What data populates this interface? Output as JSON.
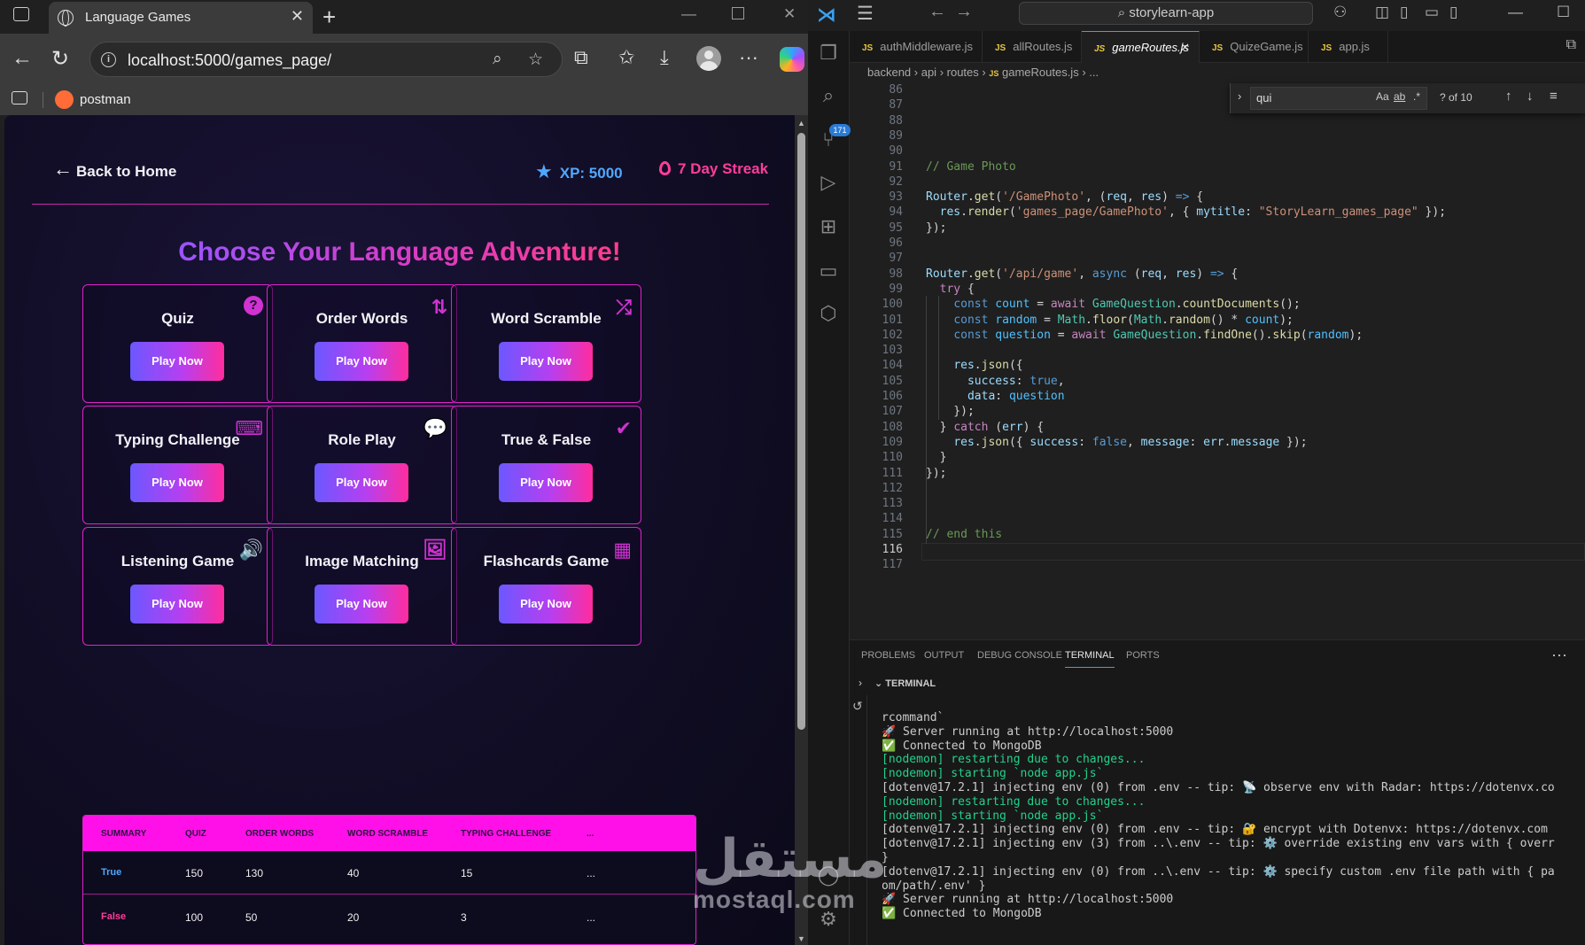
{
  "browser": {
    "tab_title": "Language Games",
    "url": "localhost:5000/games_page/",
    "bookmark": "postman",
    "icons": [
      "tab-actions-icon",
      "globe-icon",
      "close-icon",
      "new-tab-icon",
      "minimize-icon",
      "maximize-icon",
      "back-icon",
      "reload-icon",
      "info-icon",
      "zoom-icon",
      "star-icon",
      "extensions-icon",
      "favorites-icon",
      "downloads-icon",
      "profile-icon",
      "more-icon",
      "copilot-icon"
    ]
  },
  "page": {
    "back_label": "Back to Home",
    "xp_label": "XP: 5000",
    "streak_label": "7 Day Streak",
    "title": "Choose Your Language Adventure!",
    "play_label": "Play Now",
    "games": [
      {
        "title": "Quiz",
        "icon": "question-icon"
      },
      {
        "title": "Order Words",
        "icon": "sort-icon"
      },
      {
        "title": "Word Scramble",
        "icon": "shuffle-icon"
      },
      {
        "title": "Typing Challenge",
        "icon": "keyboard-icon"
      },
      {
        "title": "Role Play",
        "icon": "chat-icon"
      },
      {
        "title": "True & False",
        "icon": "check-icon"
      },
      {
        "title": "Listening Game",
        "icon": "speaker-icon"
      },
      {
        "title": "Image Matching",
        "icon": "image-icon"
      },
      {
        "title": "Flashcards Game",
        "icon": "grid-icon"
      }
    ],
    "colors": {
      "accent": "#e022c9",
      "xp": "#4fa8ff",
      "streak": "#ff3d9a",
      "table_head": "#ff10e8"
    },
    "summary": {
      "headers": [
        "SUMMARY",
        "QUIZ",
        "ORDER WORDS",
        "WORD SCRAMBLE",
        "TYPING CHALLENGE",
        "..."
      ],
      "rows": [
        {
          "label": "True",
          "values": [
            "150",
            "130",
            "40",
            "15",
            "..."
          ]
        },
        {
          "label": "False",
          "values": [
            "100",
            "50",
            "20",
            "3",
            "..."
          ]
        }
      ]
    }
  },
  "watermark": {
    "arabic": "مستقل",
    "latin": "mostaql.com"
  },
  "vscode": {
    "search": "storylearn-app",
    "tabs": [
      "authMiddleware.js",
      "allRoutes.js",
      "gameRoutes.js",
      "QuizeGame.js",
      "app.js"
    ],
    "active_tab": "gameRoutes.js",
    "tab_badge": "JS",
    "breadcrumb": [
      "backend",
      "api",
      "routes",
      "gameRoutes.js",
      "..."
    ],
    "find": {
      "query": "qui",
      "count": "? of 10",
      "opt_case": "Aa",
      "opt_word": "ab",
      "opt_regex": ".*"
    },
    "activity_badge": "171",
    "code_lines": [
      {
        "n": "86",
        "html": ""
      },
      {
        "n": "87",
        "html": ""
      },
      {
        "n": "88",
        "html": ""
      },
      {
        "n": "89",
        "html": ""
      },
      {
        "n": "90",
        "html": ""
      },
      {
        "n": "91",
        "html": "<span class='k-cm'>// Game Photo</span>"
      },
      {
        "n": "92",
        "html": ""
      },
      {
        "n": "93",
        "html": "<span class='k-var'>Router</span>.<span class='k-fn'>get</span>(<span class='k-str'>'/GamePhoto'</span>, (<span class='k-var'>req</span>, <span class='k-var'>res</span>) <span class='k-kw'>=&gt;</span> {"
      },
      {
        "n": "94",
        "html": "  <span class='k-var'>res</span>.<span class='k-fn'>render</span>(<span class='k-str'>'games_page/GamePhoto'</span>, { <span class='k-var'>mytitle</span>: <span class='k-str'>\"StoryLearn_games_page\"</span> });"
      },
      {
        "n": "95",
        "html": "});"
      },
      {
        "n": "96",
        "html": ""
      },
      {
        "n": "97",
        "html": ""
      },
      {
        "n": "98",
        "html": "<span class='k-var'>Router</span>.<span class='k-fn'>get</span>(<span class='k-str'>'/api/game'</span>, <span class='k-kw'>async</span> (<span class='k-var'>req</span>, <span class='k-var'>res</span>) <span class='k-kw'>=&gt;</span> {"
      },
      {
        "n": "99",
        "html": "  <span class='k-ctl'>try</span> {"
      },
      {
        "n": "100",
        "html": "    <span class='k-kw'>const</span> <span class='k-cst'>count</span> = <span class='k-ctl'>await</span> <span class='k-cls'>GameQuestion</span>.<span class='k-fn'>countDocuments</span>();"
      },
      {
        "n": "101",
        "html": "    <span class='k-kw'>const</span> <span class='k-cst'>random</span> = <span class='k-cls'>Math</span>.<span class='k-fn'>floor</span>(<span class='k-cls'>Math</span>.<span class='k-fn'>random</span>() * <span class='k-cst'>count</span>);"
      },
      {
        "n": "102",
        "html": "    <span class='k-kw'>const</span> <span class='k-cst'>question</span> = <span class='k-ctl'>await</span> <span class='k-cls'>GameQuestion</span>.<span class='k-fn'>findOne</span>().<span class='k-fn'>skip</span>(<span class='k-cst'>random</span>);"
      },
      {
        "n": "103",
        "html": ""
      },
      {
        "n": "104",
        "html": "    <span class='k-var'>res</span>.<span class='k-fn'>json</span>({"
      },
      {
        "n": "105",
        "html": "      <span class='k-var'>success</span>: <span class='k-kw'>true</span>,"
      },
      {
        "n": "106",
        "html": "      <span class='k-var'>data</span>: <span class='k-cst'>question</span>"
      },
      {
        "n": "107",
        "html": "    });"
      },
      {
        "n": "108",
        "html": "  } <span class='k-ctl'>catch</span> (<span class='k-var'>err</span>) {"
      },
      {
        "n": "109",
        "html": "    <span class='k-var'>res</span>.<span class='k-fn'>json</span>({ <span class='k-var'>success</span>: <span class='k-kw'>false</span>, <span class='k-var'>message</span>: <span class='k-var'>err</span>.<span class='k-var'>message</span> });"
      },
      {
        "n": "110",
        "html": "  }"
      },
      {
        "n": "111",
        "html": "});"
      },
      {
        "n": "112",
        "html": ""
      },
      {
        "n": "113",
        "html": ""
      },
      {
        "n": "114",
        "html": ""
      },
      {
        "n": "115",
        "html": "<span class='k-cm'>// end this</span>"
      },
      {
        "n": "116",
        "html": ""
      },
      {
        "n": "117",
        "html": ""
      }
    ],
    "current_line": "116",
    "panel_tabs": [
      "PROBLEMS",
      "OUTPUT",
      "DEBUG CONSOLE",
      "TERMINAL",
      "PORTS"
    ],
    "active_panel_tab": "TERMINAL",
    "terminal_title": "TERMINAL",
    "terminal_lines": [
      {
        "t": "rcommand`",
        "c": ""
      },
      {
        "t": "🚀 Server running at http://localhost:5000",
        "c": ""
      },
      {
        "t": "✅ Connected to MongoDB",
        "c": ""
      },
      {
        "t": "[nodemon] restarting due to changes...",
        "c": "green"
      },
      {
        "t": "[nodemon] starting `node app.js`",
        "c": "green"
      },
      {
        "t": "[dotenv@17.2.1] injecting env (0) from .env -- tip: 📡 observe env with Radar: https://dotenvx.co",
        "c": ""
      },
      {
        "t": "[nodemon] restarting due to changes...",
        "c": "green"
      },
      {
        "t": "[nodemon] starting `node app.js`",
        "c": "green"
      },
      {
        "t": "[dotenv@17.2.1] injecting env (0) from .env -- tip: 🔐 encrypt with Dotenvx: https://dotenvx.com",
        "c": ""
      },
      {
        "t": "[dotenv@17.2.1] injecting env (3) from ..\\.env -- tip: ⚙️ override existing env vars with { overr",
        "c": ""
      },
      {
        "t": "}",
        "c": ""
      },
      {
        "t": "[dotenv@17.2.1] injecting env (0) from ..\\.env -- tip: ⚙️ specify custom .env file path with { pa",
        "c": ""
      },
      {
        "t": "om/path/.env' }",
        "c": ""
      },
      {
        "t": "🚀 Server running at http://localhost:5000",
        "c": ""
      },
      {
        "t": "✅ Connected to MongoDB",
        "c": ""
      }
    ]
  }
}
